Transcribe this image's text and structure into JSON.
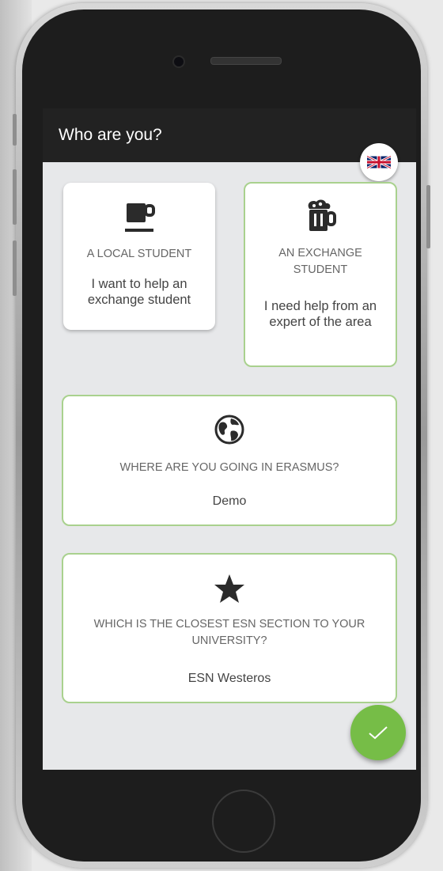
{
  "appbar": {
    "title": "Who are you?"
  },
  "language": {
    "flag_icon": "uk-flag-icon"
  },
  "role_cards": [
    {
      "title": "A LOCAL STUDENT",
      "description": "I want to help an exchange student",
      "icon": "coffee-cup-icon",
      "selected": false
    },
    {
      "title": "AN EXCHANGE STUDENT",
      "description": "I need help from an expert of the area",
      "icon": "beer-mug-icon",
      "selected": true
    }
  ],
  "destination": {
    "question": "WHERE ARE YOU GOING IN ERASMUS?",
    "value": "Demo",
    "icon": "globe-icon"
  },
  "section": {
    "question": "WHICH IS THE CLOSEST ESN SECTION TO YOUR UNIVERSITY?",
    "value": "ESN Westeros",
    "icon": "star-icon"
  },
  "confirm": {
    "icon": "check-icon"
  },
  "colors": {
    "accent": "#76bd47",
    "selected_border": "#a9d18e",
    "appbar": "#222222"
  }
}
